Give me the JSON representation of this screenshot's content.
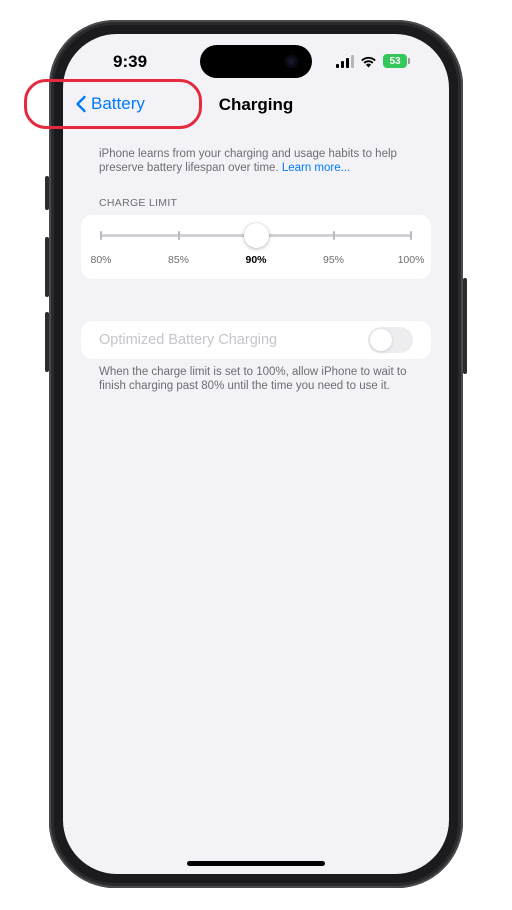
{
  "status_bar": {
    "time": "9:39",
    "battery_percent": "53",
    "icons": [
      "cellular-signal-icon",
      "wifi-icon",
      "battery-charging-icon"
    ],
    "battery_color": "#34c759"
  },
  "nav": {
    "back_label": "Battery",
    "title": "Charging",
    "accent_color": "#007aff"
  },
  "intro": {
    "text": "iPhone learns from your charging and usage habits to help preserve battery lifespan over time.",
    "link": "Learn more..."
  },
  "charge_limit": {
    "header": "CHARGE LIMIT",
    "options": [
      "80%",
      "85%",
      "90%",
      "95%",
      "100%"
    ],
    "selected": "90%",
    "selected_index": 2
  },
  "optimized_charging": {
    "label": "Optimized Battery Charging",
    "enabled": false,
    "disabled_state": true
  },
  "footer_note": "When the charge limit is set to 100%, allow iPhone to wait to finish charging past 80% until the time you need to use it.",
  "annotation": {
    "highlight_color": "#e5293f",
    "highlights": "back-button"
  }
}
